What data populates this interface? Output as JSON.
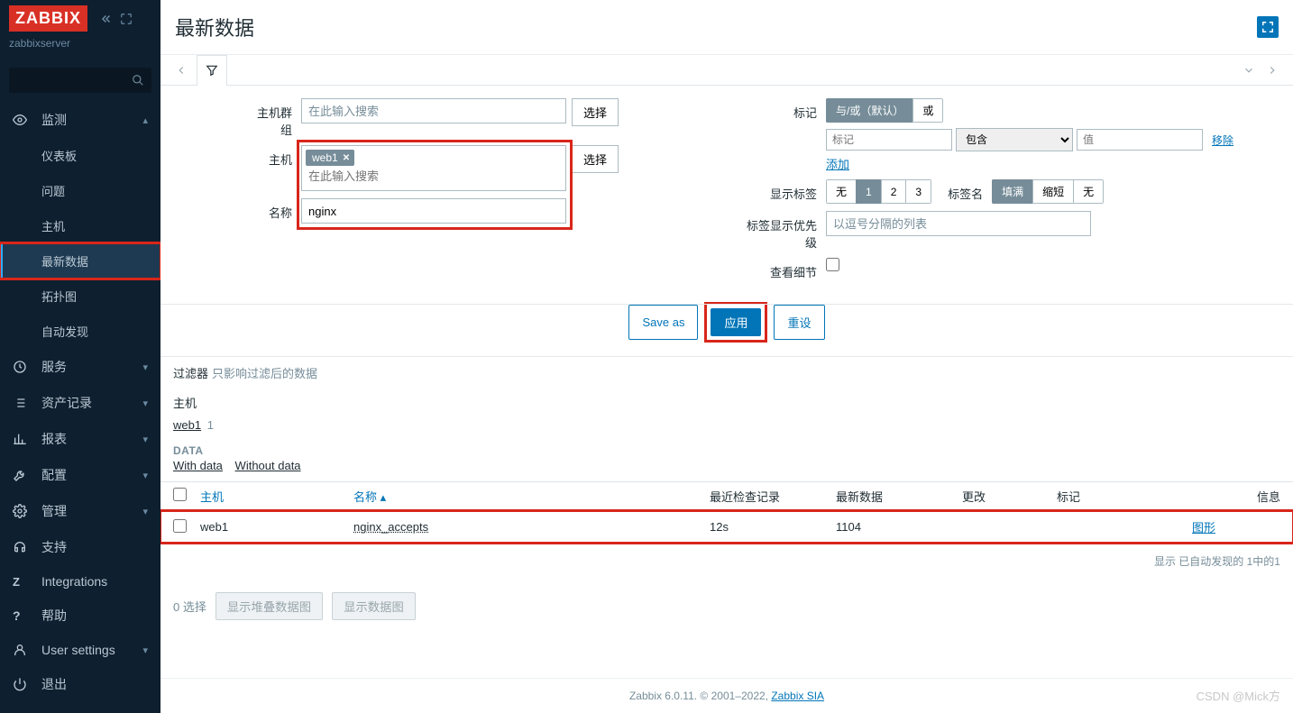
{
  "brand": "ZABBIX",
  "server_name": "zabbixserver",
  "page_title": "最新数据",
  "sidebar": {
    "search_placeholder": "",
    "groups": [
      {
        "icon": "eye",
        "label": "监测",
        "expanded": true,
        "items": [
          {
            "label": "仪表板",
            "active": false
          },
          {
            "label": "问题",
            "active": false
          },
          {
            "label": "主机",
            "active": false
          },
          {
            "label": "最新数据",
            "active": true
          },
          {
            "label": "拓扑图",
            "active": false
          },
          {
            "label": "自动发现",
            "active": false
          }
        ]
      },
      {
        "icon": "clock",
        "label": "服务",
        "expanded": false
      },
      {
        "icon": "list",
        "label": "资产记录",
        "expanded": false
      },
      {
        "icon": "bar",
        "label": "报表",
        "expanded": false
      },
      {
        "icon": "wrench",
        "label": "配置",
        "expanded": false
      },
      {
        "icon": "gear",
        "label": "管理",
        "expanded": false
      }
    ],
    "footer": [
      {
        "icon": "headset",
        "label": "支持"
      },
      {
        "icon": "z",
        "label": "Integrations"
      },
      {
        "icon": "question",
        "label": "帮助"
      },
      {
        "icon": "user",
        "label": "User settings",
        "chev": true
      },
      {
        "icon": "power",
        "label": "退出"
      }
    ]
  },
  "filter": {
    "left": {
      "hostgroup_label": "主机群组",
      "hostgroup_placeholder": "在此输入搜索",
      "select_btn": "选择",
      "host_label": "主机",
      "host_tag": "web1",
      "host_placeholder": "在此输入搜索",
      "name_label": "名称",
      "name_value": "nginx"
    },
    "right": {
      "tags_label": "标记",
      "tags_opt_andor": "与/或（默认）",
      "tags_opt_or": "或",
      "tag_key_placeholder": "标记",
      "tag_op": "包含",
      "tag_val_placeholder": "值",
      "remove": "移除",
      "add": "添加",
      "showtags_label": "显示标签",
      "showtags_none": "无",
      "showtags_1": "1",
      "showtags_2": "2",
      "showtags_3": "3",
      "tagname_label": "标签名",
      "tagname_full": "填满",
      "tagname_short": "缩短",
      "tagname_none": "无",
      "tagprio_label": "标签显示优先级",
      "tagprio_placeholder": "以逗号分隔的列表",
      "details_label": "查看细节"
    },
    "actions": {
      "save_as": "Save as",
      "apply": "应用",
      "reset": "重设"
    }
  },
  "meta": {
    "filter_label": "过滤器",
    "filter_note": "只影响过滤后的数据",
    "hosts_head": "主机",
    "host_name": "web1",
    "host_count": "1",
    "data_head": "DATA",
    "with_data": "With data",
    "without_data": "Without data"
  },
  "columns": {
    "host": "主机",
    "name": "名称",
    "lastcheck": "最近检查记录",
    "lastval": "最新数据",
    "change": "更改",
    "tags": "标记",
    "info": "信息"
  },
  "rows": [
    {
      "host": "web1",
      "name": "nginx_accepts",
      "lastcheck": "12s",
      "lastval": "1104",
      "graph": "图形"
    }
  ],
  "table_footer": "显示 已自动发现的 1中的1",
  "selectbar": {
    "label": "0 选择",
    "btn1": "显示堆叠数据图",
    "btn2": "显示数据图"
  },
  "footer": {
    "text": "Zabbix 6.0.11. © 2001–2022, ",
    "link": "Zabbix SIA"
  },
  "watermark": "CSDN @Mick方"
}
